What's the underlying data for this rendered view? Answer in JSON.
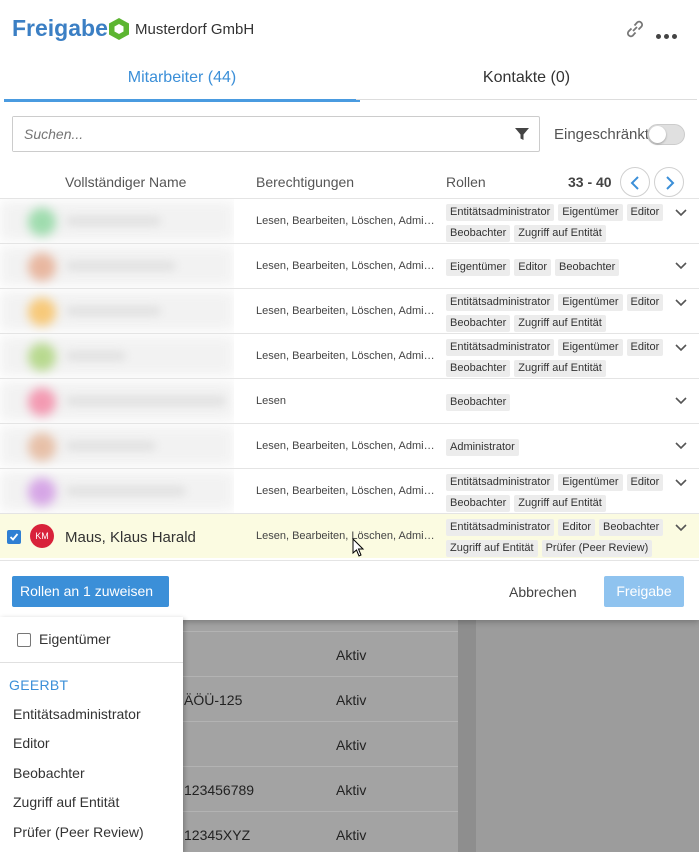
{
  "header": {
    "title": "Freigabe",
    "org_name": "Musterdorf GmbH"
  },
  "tabs": [
    {
      "label": "Mitarbeiter (44)",
      "active": true
    },
    {
      "label": "Kontakte (0)",
      "active": false
    }
  ],
  "search": {
    "placeholder": "Suchen...",
    "value": ""
  },
  "restricted": {
    "label": "Eingeschränkt",
    "on": false
  },
  "table": {
    "columns": {
      "name": "Vollständiger Name",
      "permissions": "Berechtigungen",
      "roles": "Rollen"
    },
    "range": "33 - 40",
    "rows": [
      {
        "name_visible": false,
        "permissions": "Lesen, Bearbeiten, Löschen, Administrieren",
        "roles": [
          "Entitätsadministrator",
          "Eigentümer",
          "Editor",
          "Beobachter",
          "Zugriff auf Entität"
        ]
      },
      {
        "name_visible": false,
        "permissions": "Lesen, Bearbeiten, Löschen, Administrieren",
        "roles": [
          "Eigentümer",
          "Editor",
          "Beobachter"
        ]
      },
      {
        "name_visible": false,
        "permissions": "Lesen, Bearbeiten, Löschen, Administrieren",
        "roles": [
          "Entitätsadministrator",
          "Eigentümer",
          "Editor",
          "Beobachter",
          "Zugriff auf Entität"
        ]
      },
      {
        "name_visible": false,
        "permissions": "Lesen, Bearbeiten, Löschen, Administrieren",
        "roles": [
          "Entitätsadministrator",
          "Eigentümer",
          "Editor",
          "Beobachter",
          "Zugriff auf Entität"
        ]
      },
      {
        "name_visible": false,
        "permissions": "Lesen",
        "roles": [
          "Beobachter"
        ]
      },
      {
        "name_visible": false,
        "permissions": "Lesen, Bearbeiten, Löschen, Administrieren",
        "roles": [
          "Administrator"
        ]
      },
      {
        "name_visible": false,
        "permissions": "Lesen, Bearbeiten, Löschen, Administrieren",
        "roles": [
          "Entitätsadministrator",
          "Eigentümer",
          "Editor",
          "Beobachter",
          "Zugriff auf Entität"
        ]
      },
      {
        "name_visible": true,
        "selected": true,
        "initials": "KM",
        "name": "Maus, Klaus Harald",
        "permissions": "Lesen, Bearbeiten, Löschen, Administrieren",
        "roles": [
          "Entitätsadministrator",
          "Editor",
          "Beobachter",
          "Zugriff auf Entität",
          "Prüfer (Peer Review)"
        ]
      }
    ]
  },
  "footer": {
    "assign_label": "Rollen an 1 zuweisen",
    "cancel_label": "Abbrechen",
    "share_label": "Freigabe"
  },
  "dropdown": {
    "owner_label": "Eigentümer",
    "inherited_heading": "GEERBT",
    "inherited_items": [
      "Entitätsadministrator",
      "Editor",
      "Beobachter",
      "Zugriff auf Entität",
      "Prüfer (Peer Review)"
    ]
  },
  "background_rows": [
    {
      "c1": "",
      "c2": "Aktiv"
    },
    {
      "c1": "ÄÖÜ-125",
      "c2": "Aktiv"
    },
    {
      "c1": "",
      "c2": "Aktiv"
    },
    {
      "c1": "123456789",
      "c2": "Aktiv"
    },
    {
      "c1": "12345XYZ",
      "c2": "Aktiv"
    }
  ],
  "colors": {
    "accent": "#3b8fd8",
    "title": "#3b7fc4",
    "avatar": "#d8223a",
    "selected_row": "#fbfbe1",
    "org_icon": "#5cb531"
  },
  "icons": {
    "org": "hexagon-icon",
    "link": "link-icon",
    "more": "more-icon",
    "filter": "filter-icon"
  }
}
